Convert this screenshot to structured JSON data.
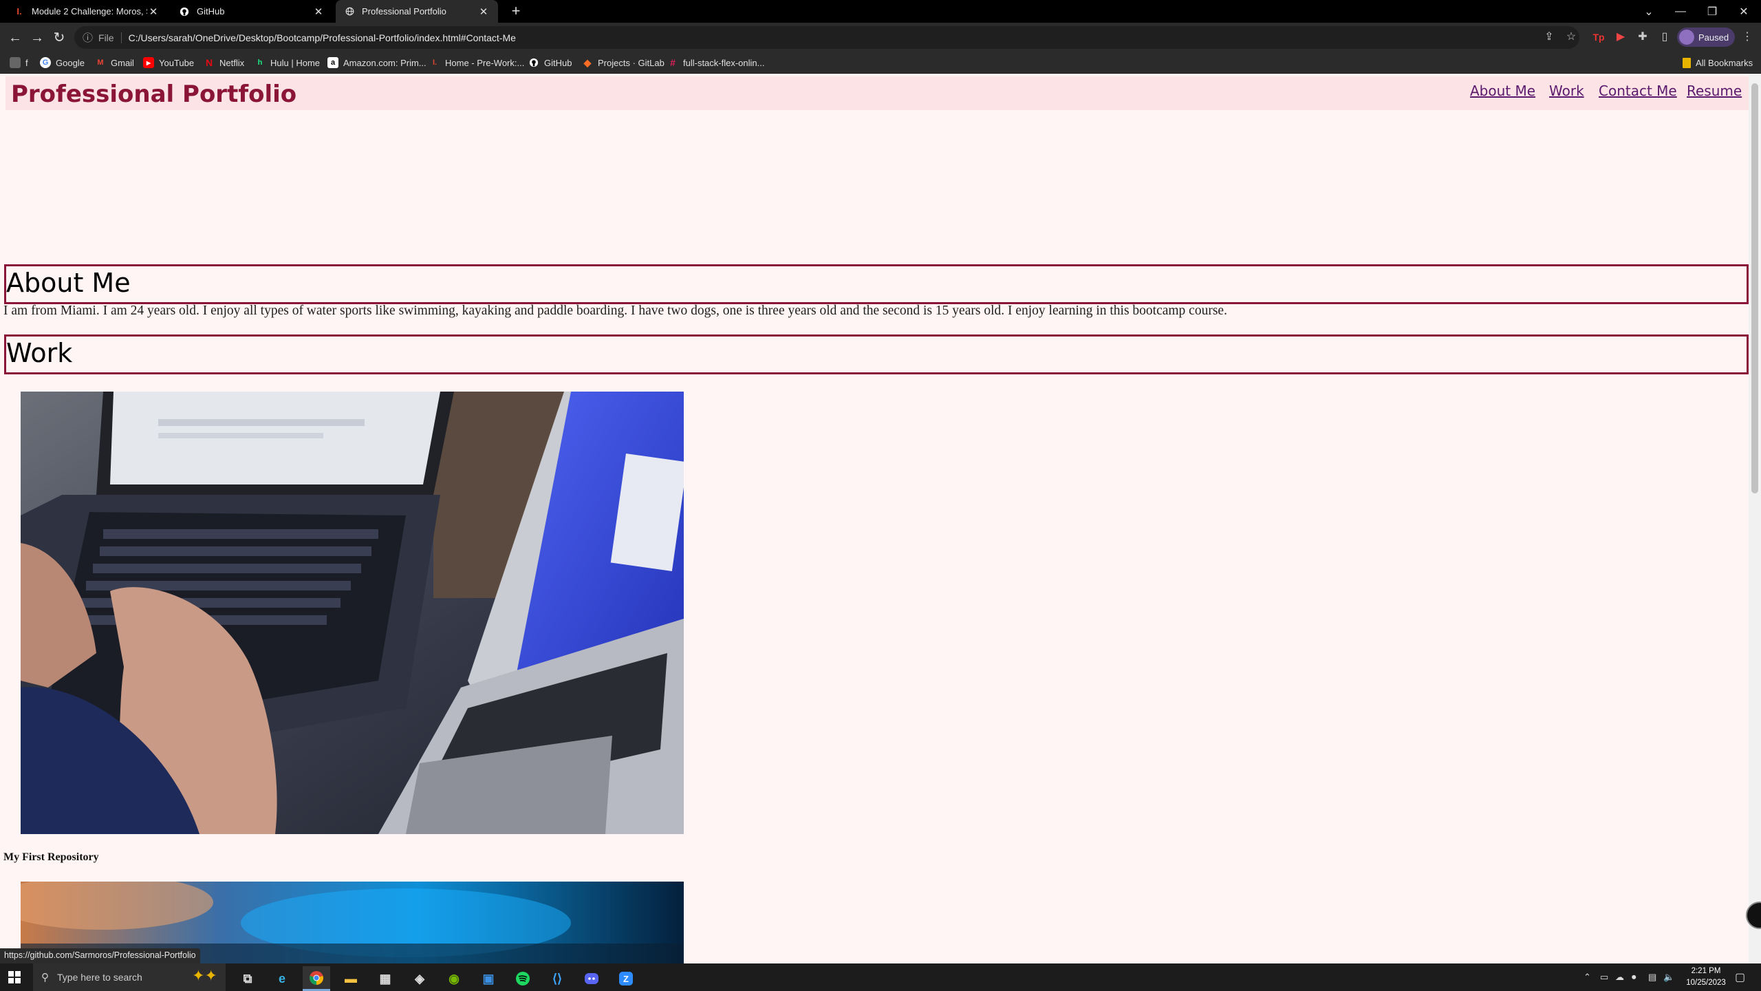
{
  "browser": {
    "tabs": [
      {
        "title": "Module 2 Challenge: Moros, Sar",
        "icon": "canvas-icon",
        "active": false
      },
      {
        "title": "GitHub",
        "icon": "github-icon",
        "active": false
      },
      {
        "title": "Professional Portfolio",
        "icon": "globe-icon",
        "active": true
      }
    ],
    "omnibox": {
      "scheme_label": "File",
      "url": "C:/Users/sarah/OneDrive/Desktop/Bootcamp/Professional-Portfolio/index.html#Contact-Me"
    },
    "profile_label": "Paused",
    "bookmarks": [
      {
        "label": "f",
        "icon": "folder-icon"
      },
      {
        "label": "Google",
        "icon": "google-icon"
      },
      {
        "label": "Gmail",
        "icon": "gmail-icon"
      },
      {
        "label": "YouTube",
        "icon": "youtube-icon"
      },
      {
        "label": "Netflix",
        "icon": "netflix-icon"
      },
      {
        "label": "Hulu | Home",
        "icon": "hulu-icon"
      },
      {
        "label": "Amazon.com: Prim...",
        "icon": "amazon-icon"
      },
      {
        "label": "Home - Pre-Work:...",
        "icon": "canvas-icon"
      },
      {
        "label": "GitHub",
        "icon": "github-icon"
      },
      {
        "label": "Projects · GitLab",
        "icon": "gitlab-icon"
      },
      {
        "label": "full-stack-flex-onlin...",
        "icon": "slack-icon"
      }
    ],
    "all_bookmarks": "All Bookmarks",
    "status_url": "https://github.com/Sarmoros/Professional-Portfolio"
  },
  "page": {
    "site_title": "Professional Portfolio",
    "nav": [
      "About Me",
      "Work",
      "Contact Me",
      "Resume"
    ],
    "about_heading": "About Me",
    "about_text": "I am from Miami. I am 24 years old. I enjoy all types of water sports like swimming, kayaking and paddle boarding. I have two dogs, one is three years old and the second is 15 years old. I enjoy learning in this bootcamp course.",
    "work_heading": "Work",
    "project_caption": "My First Repository",
    "colors": {
      "accent": "#8a1538",
      "background": "#fff5f5",
      "header_bg": "#fce3e6",
      "nav_link": "#5b1a6e"
    }
  },
  "taskbar": {
    "search_placeholder": "Type here to search",
    "apps": [
      "task-view-icon",
      "edge-icon",
      "chrome-icon",
      "file-explorer-icon",
      "store-icon",
      "steam-icon",
      "nvidia-icon",
      "app-icon",
      "spotify-icon",
      "vscode-icon",
      "discord-icon",
      "zoom-icon"
    ],
    "time": "2:21 PM",
    "date": "10/25/2023"
  }
}
